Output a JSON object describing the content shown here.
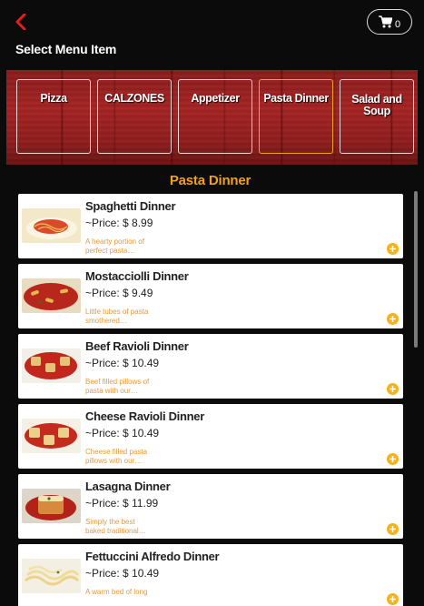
{
  "header": {
    "back_icon": "chevron-left-icon",
    "cart_icon": "shopping-cart-icon",
    "cart_count": "0",
    "page_title": "Select Menu Item"
  },
  "categories": [
    {
      "label": "Pizza",
      "active": false
    },
    {
      "label": "CALZONES",
      "active": false
    },
    {
      "label": "Appetizer",
      "active": false
    },
    {
      "label": "Pasta Dinner",
      "active": true
    },
    {
      "label": "Salad and Soup",
      "active": false
    }
  ],
  "section_title": "Pasta Dinner",
  "items": [
    {
      "name": "Spaghetti Dinner",
      "price": "~Price: $ 8.99",
      "description": "A hearty portion of perfect pasta…"
    },
    {
      "name": "Mostacciolli Dinner",
      "price": "~Price: $ 9.49",
      "description": "Little tubes of pasta smothered…"
    },
    {
      "name": "Beef Ravioli Dinner",
      "price": "~Price: $ 10.49",
      "description": "Beef filled pillows of pasta with our…"
    },
    {
      "name": "Cheese Ravioli Dinner",
      "price": "~Price: $ 10.49",
      "description": "Cheese filled pasta pillows with our…"
    },
    {
      "name": "Lasagna Dinner",
      "price": "~Price: $ 11.99",
      "description": "Simply the best baked traditional…"
    },
    {
      "name": "Fettuccini Alfredo Dinner",
      "price": "~Price: $ 10.49",
      "description": "A warm bed of long"
    }
  ],
  "colors": {
    "accent": "#f2a11c",
    "back_arrow": "#e0201e",
    "category_wood": "#a82424",
    "add_button": "#f5b21a",
    "description_text": "#e69a3a"
  }
}
